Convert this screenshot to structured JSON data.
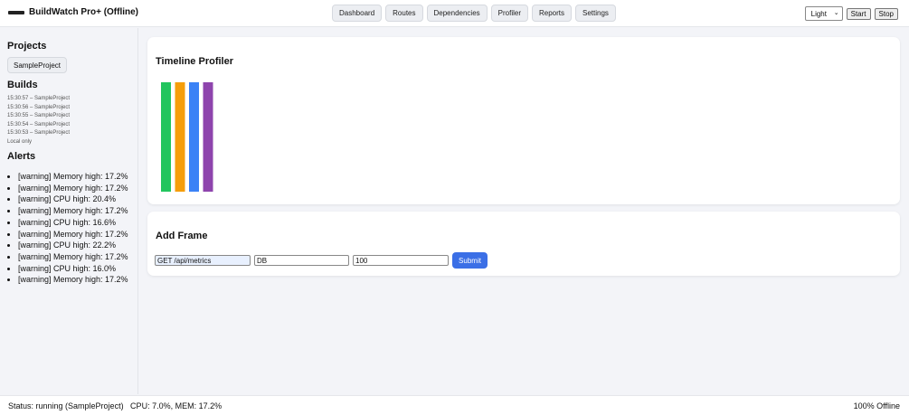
{
  "app": {
    "title": "BuildWatch Pro+ (Offline)"
  },
  "nav": [
    "Dashboard",
    "Routes",
    "Dependencies",
    "Profiler",
    "Reports",
    "Settings"
  ],
  "controls": {
    "theme": "Light",
    "start_label": "Start",
    "stop_label": "Stop"
  },
  "sidebar": {
    "projects_heading": "Projects",
    "project": "SampleProject",
    "builds_heading": "Builds",
    "builds": [
      "15:30:57 – SampleProject",
      "15:30:56 – SampleProject",
      "15:30:55 – SampleProject",
      "15:30:54 – SampleProject",
      "15:30:53 – SampleProject"
    ],
    "builds_note": "Local only",
    "alerts_heading": "Alerts",
    "alerts": [
      "[warning] Memory high: 17.2%",
      "[warning] Memory high: 17.2%",
      "[warning] CPU high: 20.4%",
      "[warning] Memory high: 17.2%",
      "[warning] CPU high: 16.6%",
      "[warning] Memory high: 17.2%",
      "[warning] CPU high: 22.2%",
      "[warning] Memory high: 17.2%",
      "[warning] CPU high: 16.0%",
      "[warning] Memory high: 17.2%"
    ]
  },
  "profiler": {
    "title": "Timeline Profiler",
    "bars": [
      {
        "color": "#22c55e"
      },
      {
        "color": "#f59e0b"
      },
      {
        "color": "#3b82f6"
      },
      {
        "color": "#8e44ad"
      }
    ]
  },
  "add_frame": {
    "title": "Add Frame",
    "route_value": "GET /api/metrics",
    "type_value": "DB",
    "duration_value": "100",
    "submit_label": "Submit"
  },
  "status": {
    "left": "Status: running (SampleProject)   CPU: 7.0%, MEM: 17.2%",
    "right": "100% Offline"
  }
}
